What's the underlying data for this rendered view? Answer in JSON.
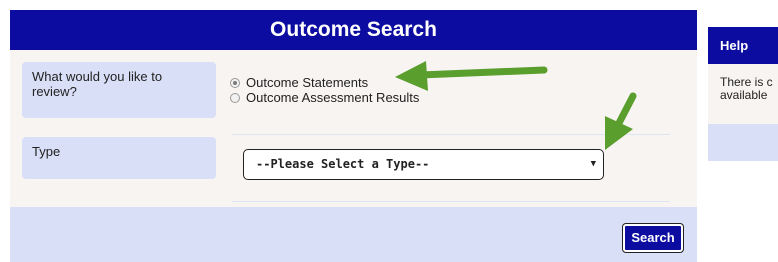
{
  "search_panel": {
    "title": "Outcome Search",
    "review_label": "What would you like to review?",
    "review_options": [
      {
        "label": "Outcome Statements",
        "selected": true
      },
      {
        "label": "Outcome Assessment Results",
        "selected": false
      }
    ],
    "type_label": "Type",
    "type_select": {
      "value": "--Please Select a Type--"
    },
    "search_button": "Search"
  },
  "help_panel": {
    "title": "Help",
    "body_line1": "There is c",
    "body_line2": "available"
  },
  "annotations": {
    "arrow_color": "#5a9e2e"
  },
  "colors": {
    "primary": "#0c0ca0",
    "label_background": "#d9dff7",
    "form_background": "#f8f4f2"
  }
}
